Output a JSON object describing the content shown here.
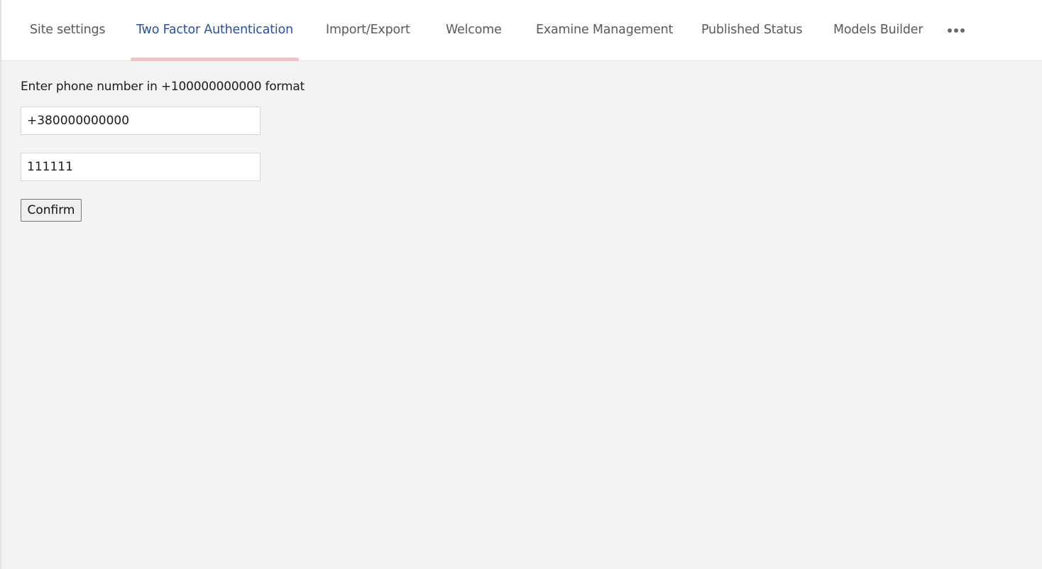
{
  "tabs": [
    {
      "label": "Site settings",
      "active": false
    },
    {
      "label": "Two Factor Authentication",
      "active": true
    },
    {
      "label": "Import/Export",
      "active": false
    },
    {
      "label": "Welcome",
      "active": false
    },
    {
      "label": "Examine Management",
      "active": false
    },
    {
      "label": "Published Status",
      "active": false
    },
    {
      "label": "Models Builder",
      "active": false
    }
  ],
  "more_icon": "ellipsis-icon",
  "form": {
    "instruction": "Enter phone number in +100000000000 format",
    "phone_value": "+380000000000",
    "code_value": "111111",
    "confirm_label": "Confirm"
  },
  "colors": {
    "active_tab_text": "#2a4fa0",
    "active_tab_indicator": "#f5c1bc",
    "background": "#f4f3f4"
  }
}
